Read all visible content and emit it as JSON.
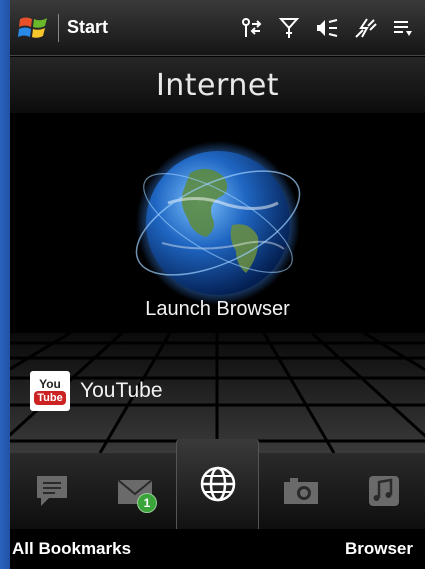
{
  "status_bar": {
    "start_label": "Start",
    "icons": [
      "windows-logo-icon",
      "connectivity-icon",
      "signal-icon",
      "volume-icon",
      "battery-charging-icon",
      "menu-icon"
    ]
  },
  "header": {
    "title": "Internet"
  },
  "main": {
    "launch_browser_label": "Launch Browser",
    "youtube": {
      "icon_top": "You",
      "icon_bottom": "Tube",
      "label": "YouTube"
    }
  },
  "tabs": [
    {
      "name": "messaging",
      "icon": "message-icon"
    },
    {
      "name": "mail",
      "icon": "mail-icon",
      "badge": "1"
    },
    {
      "name": "internet",
      "icon": "globe-icon",
      "active": true
    },
    {
      "name": "camera",
      "icon": "camera-icon"
    },
    {
      "name": "music",
      "icon": "music-icon"
    }
  ],
  "softkeys": {
    "left": "All Bookmarks",
    "right": "Browser"
  },
  "colors": {
    "background": "#000000",
    "accent_blue": "#1d4e9e",
    "badge_green": "#3aa43a",
    "youtube_red": "#cc2222"
  }
}
